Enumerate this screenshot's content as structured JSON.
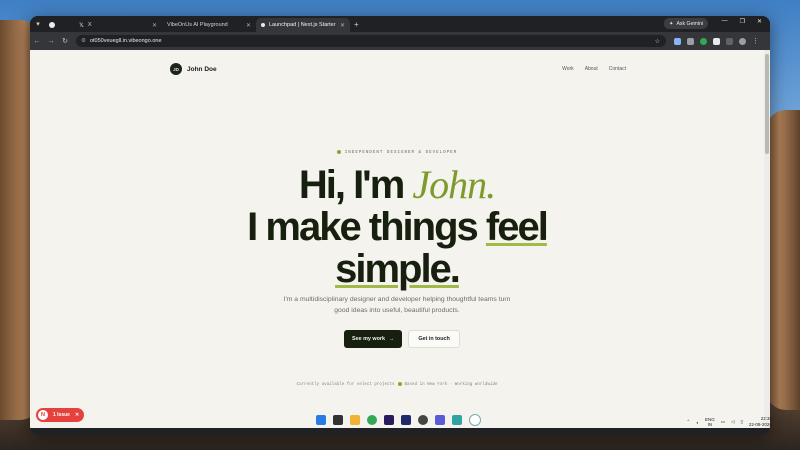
{
  "browser": {
    "tabs": [
      {
        "label": "X",
        "active": false
      },
      {
        "label": "VibeOnUs AI Playground",
        "active": false
      },
      {
        "label": "Launchpad | Next.js Starter",
        "active": true
      }
    ],
    "new_tab": "+",
    "ask_gemini": "Ask Gemini",
    "url": "ot050veuegll.in.vibeongo.one"
  },
  "site": {
    "logo_initials": "JD",
    "brand": "John Doe",
    "nav": [
      "Work",
      "About",
      "Contact"
    ],
    "eyebrow": "INDEPENDENT DESIGNER & DEVELOPER",
    "headline": {
      "line1_a": "Hi, I'm ",
      "line1_accent": "John.",
      "line2_a": "I make things ",
      "line2_ul": "feel",
      "line3_ul": "simple."
    },
    "subtitle": "I'm a multidisciplinary designer and developer helping thoughtful teams turn good ideas into useful, beautiful products.",
    "cta_primary": "See my work",
    "cta_primary_arrow": "→",
    "cta_secondary": "Get in touch",
    "availability_a": "Currently available for select projects",
    "availability_b": "Based in New York · Working worldwide"
  },
  "devtools": {
    "badge_letter": "N",
    "issue_label": "1 Issue"
  },
  "taskbar": {
    "lang_line1": "ENG",
    "lang_line2": "IN",
    "time": "22:38",
    "date": "22-09-2026"
  },
  "colors": {
    "accent_green": "#7f9a2c",
    "dark": "#17200f",
    "page_bg": "#f4f3ee",
    "issue_red": "#e5423e"
  }
}
